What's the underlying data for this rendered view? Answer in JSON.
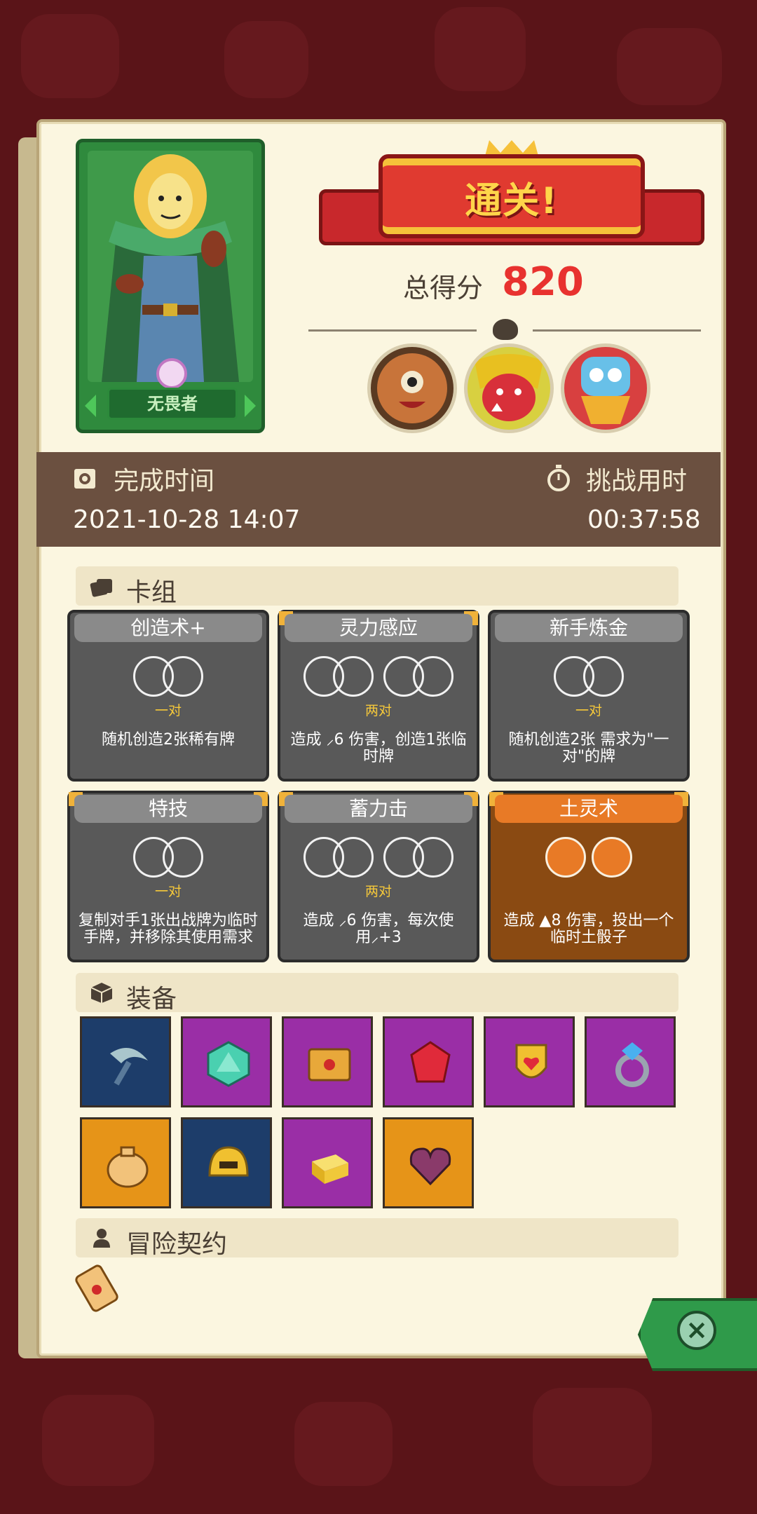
{
  "hero": {
    "name": "无畏者"
  },
  "result": {
    "title": "通关!",
    "score_label": "总得分",
    "score": "820"
  },
  "time": {
    "finish_label": "完成时间",
    "finish_value": "2021-10-28 14:07",
    "duration_label": "挑战用时",
    "duration_value": "00:37:58"
  },
  "deck": {
    "title": "卡组",
    "cards": [
      {
        "name": "创造术+",
        "pair": "一对",
        "desc": "随机创造2张稀有牌",
        "slots": 2,
        "color": "gray"
      },
      {
        "name": "灵力感应",
        "pair": "两对",
        "desc": "造成 ⸝6 伤害，创造1张临时牌",
        "slots": 4,
        "color": "gray"
      },
      {
        "name": "新手炼金",
        "pair": "一对",
        "desc": "随机创造2张 需求为\"一对\"的牌",
        "slots": 2,
        "color": "gray"
      },
      {
        "name": "特技",
        "pair": "一对",
        "desc": "复制对手1张出战牌为临时手牌，并移除其使用需求",
        "slots": 2,
        "color": "gray"
      },
      {
        "name": "蓄力击",
        "pair": "两对",
        "desc": "造成 ⸝6 伤害，每次使用⸝+3",
        "slots": 4,
        "color": "gray"
      },
      {
        "name": "土灵术",
        "pair": "",
        "desc": "造成 ▲8 伤害，投出一个临时土骰子",
        "slots": 2,
        "color": "orange"
      }
    ]
  },
  "equipment": {
    "title": "装备",
    "items": [
      {
        "icon": "scythe-icon",
        "bg": "blue"
      },
      {
        "icon": "d20-dice-icon",
        "bg": "purple"
      },
      {
        "icon": "spellbook-icon",
        "bg": "purple"
      },
      {
        "icon": "ruby-gem-icon",
        "bg": "purple"
      },
      {
        "icon": "heart-shield-icon",
        "bg": "purple"
      },
      {
        "icon": "diamond-ring-icon",
        "bg": "purple"
      },
      {
        "icon": "coin-bag-icon",
        "bg": "orange"
      },
      {
        "icon": "golden-helmet-icon",
        "bg": "blue"
      },
      {
        "icon": "gold-bar-icon",
        "bg": "purple"
      },
      {
        "icon": "cursed-heart-icon",
        "bg": "orange"
      }
    ]
  },
  "contract": {
    "title": "冒险契约"
  },
  "colors": {
    "accent_red": "#e8322f",
    "panel": "#fbf6e0",
    "timebar": "#6b5040"
  }
}
